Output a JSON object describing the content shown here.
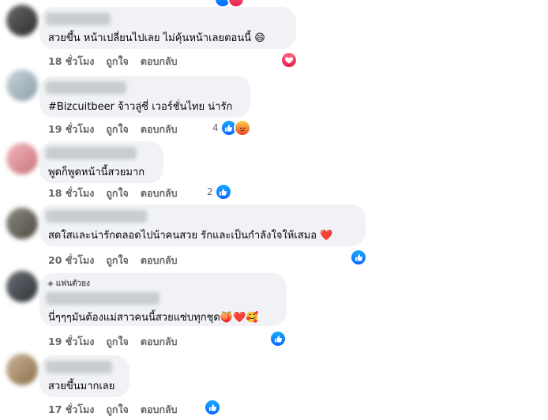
{
  "comments": [
    {
      "text": "สวยขึ้น หน้าเปลี่ยนไปเลย ไม่คุ้นหน้าเลยตอนนี้ 😄",
      "time": "18 ชั่วโมง",
      "like_label": "ถูกใจ",
      "reply_label": "ตอบกลับ",
      "reactions": [
        "love"
      ],
      "count": ""
    },
    {
      "text": "#Bizcuitbeer จ้าวลู่ซี่ เวอร์ชั่นไทย น่ารัก",
      "time": "19 ชั่วโมง",
      "like_label": "ถูกใจ",
      "reply_label": "ตอบกลับ",
      "reactions": [
        "like",
        "angry"
      ],
      "count": "4"
    },
    {
      "text": "พูดก็พูดหน้านี้สวยมาก",
      "time": "18 ชั่วโมง",
      "like_label": "ถูกใจ",
      "reply_label": "ตอบกลับ",
      "reactions": [
        "like"
      ],
      "count": "2"
    },
    {
      "text": "สดใสและน่ารักตลอดไปน้าคนสวย รักและเป็นกำลังใจให้เสมอ ❤️",
      "time": "20 ชั่วโมง",
      "like_label": "ถูกใจ",
      "reply_label": "ตอบกลับ",
      "reactions": [
        "like"
      ],
      "count": ""
    },
    {
      "badge": "แฟนตัวยง",
      "text": "นี่ๆๆๆมันต้องแม่สาวคนนี้สวยแซ่บทุกชุด🍑❤️🥰",
      "time": "19 ชั่วโมง",
      "like_label": "ถูกใจ",
      "reply_label": "ตอบกลับ",
      "reactions": [
        "like"
      ],
      "count": ""
    },
    {
      "text": "สวยขึ้นมากเลย",
      "time": "17 ชั่วโมง",
      "like_label": "ถูกใจ",
      "reply_label": "ตอบกลับ",
      "reactions": [
        "like"
      ],
      "count": ""
    }
  ],
  "colors": {
    "bubble": "#f0f2f5",
    "like": "#0866ff",
    "love": "#e61e4d",
    "meta_text": "#65676b"
  }
}
